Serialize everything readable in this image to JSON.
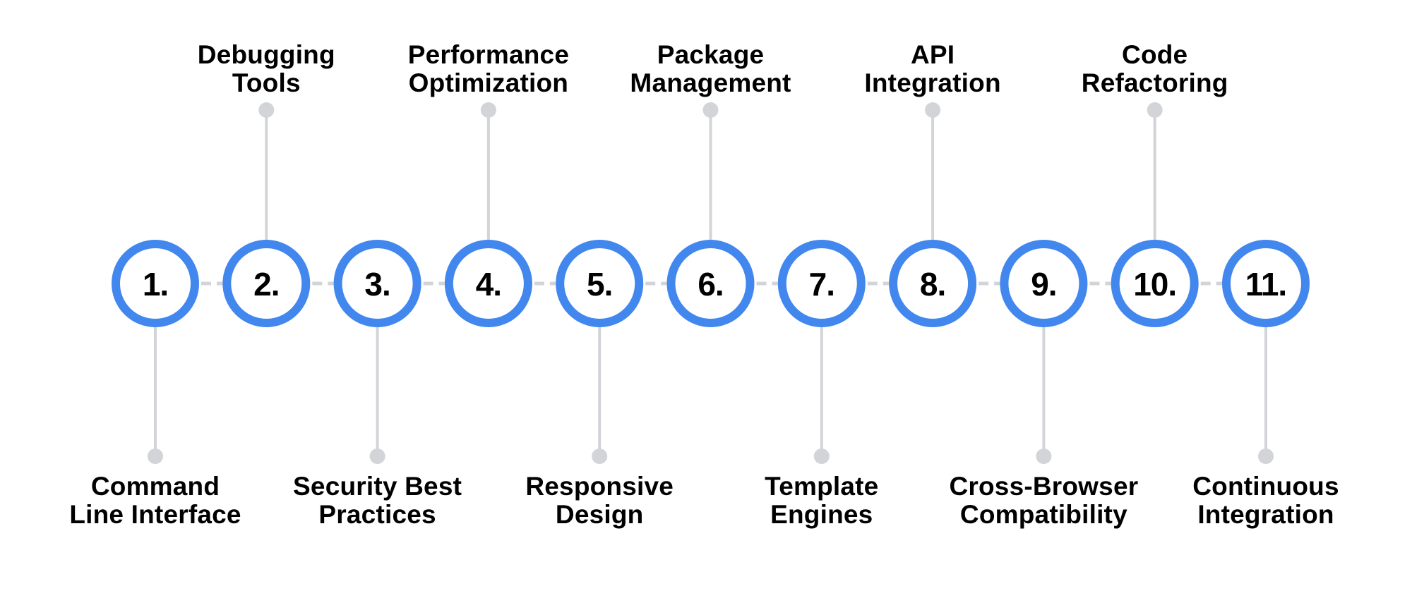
{
  "diagram": {
    "type": "horizontal-timeline",
    "colors": {
      "ring": "#4287EE",
      "connector": "#D2D4D8",
      "text": "#000000",
      "background": "#FFFFFF"
    },
    "steps": [
      {
        "number": "1.",
        "label_lines": [
          "Command",
          "Line Interface"
        ],
        "position": "bottom"
      },
      {
        "number": "2.",
        "label_lines": [
          "Debugging",
          "Tools"
        ],
        "position": "top"
      },
      {
        "number": "3.",
        "label_lines": [
          "Security Best",
          "Practices"
        ],
        "position": "bottom"
      },
      {
        "number": "4.",
        "label_lines": [
          "Performance",
          "Optimization"
        ],
        "position": "top"
      },
      {
        "number": "5.",
        "label_lines": [
          "Responsive",
          "Design"
        ],
        "position": "bottom"
      },
      {
        "number": "6.",
        "label_lines": [
          "Package",
          "Management"
        ],
        "position": "top"
      },
      {
        "number": "7.",
        "label_lines": [
          "Template",
          "Engines"
        ],
        "position": "bottom"
      },
      {
        "number": "8.",
        "label_lines": [
          "API",
          "Integration"
        ],
        "position": "top"
      },
      {
        "number": "9.",
        "label_lines": [
          "Cross-Browser",
          "Compatibility"
        ],
        "position": "bottom"
      },
      {
        "number": "10.",
        "label_lines": [
          "Code",
          "Refactoring"
        ],
        "position": "top"
      },
      {
        "number": "11.",
        "label_lines": [
          "Continuous",
          "Integration"
        ],
        "position": "bottom"
      }
    ]
  }
}
